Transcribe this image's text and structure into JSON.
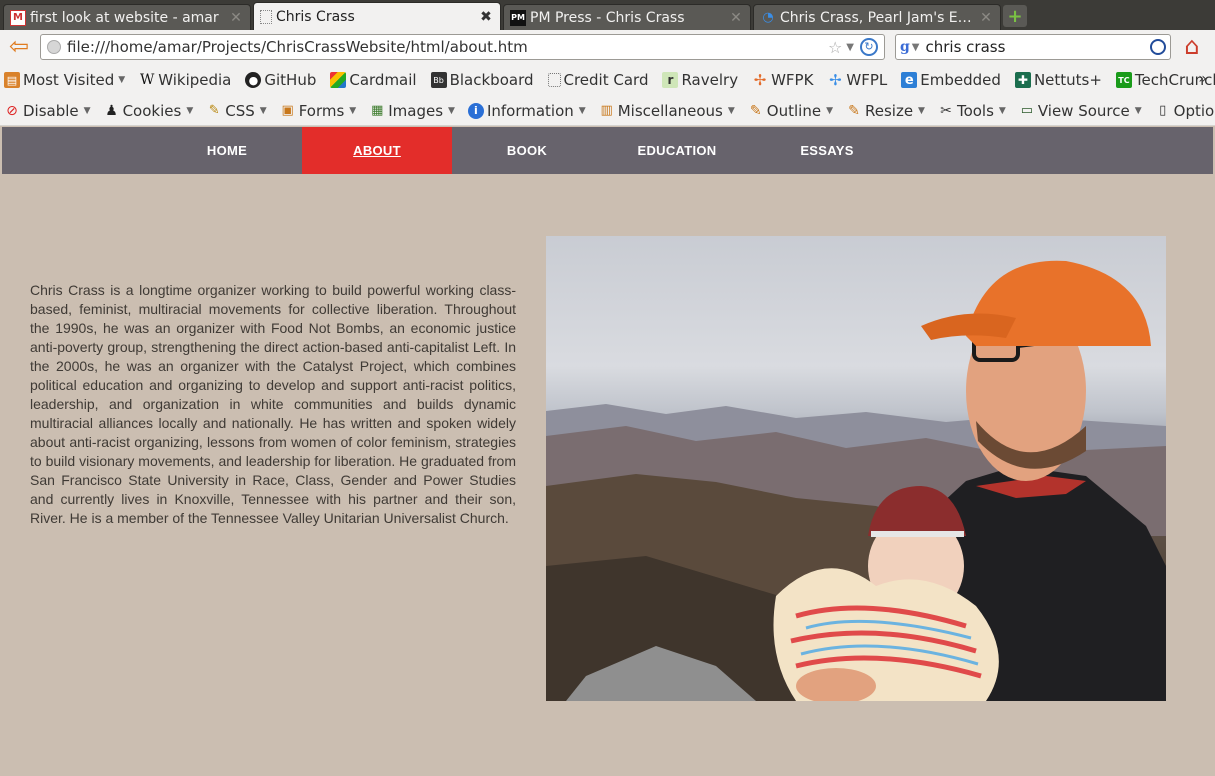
{
  "tabs": [
    {
      "title": "first look at website - amar",
      "icon": "gmail-icon",
      "active": false
    },
    {
      "title": "Chris Crass",
      "icon": "blank-page-icon",
      "active": true
    },
    {
      "title": "PM Press - Chris Crass",
      "icon": "pm-press-icon",
      "icon_text": "PM",
      "active": false
    },
    {
      "title": "Chris Crass, Pearl Jam's Ed...",
      "icon": "wifi-icon",
      "active": false
    }
  ],
  "toolbar": {
    "url": "file:///home/amar/Projects/ChrisCrassWebsite/html/about.htm",
    "search_value": "chris crass",
    "search_engine_letter": "g"
  },
  "bookmarks": [
    {
      "label": "Most Visited",
      "icon": "most-visited-icon",
      "dropdown": true
    },
    {
      "label": "Wikipedia",
      "icon": "wikipedia-icon",
      "icon_text": "W"
    },
    {
      "label": "GitHub",
      "icon": "github-icon"
    },
    {
      "label": "Cardmail",
      "icon": "cardmail-icon"
    },
    {
      "label": "Blackboard",
      "icon": "blackboard-icon",
      "icon_text": "Bb"
    },
    {
      "label": "Credit Card",
      "icon": "credit-card-icon"
    },
    {
      "label": "Ravelry",
      "icon": "ravelry-icon",
      "icon_text": "r"
    },
    {
      "label": "WFPK",
      "icon": "wfpk-icon"
    },
    {
      "label": "WFPL",
      "icon": "wfpl-icon"
    },
    {
      "label": "Embedded",
      "icon": "embedded-icon",
      "icon_text": "e"
    },
    {
      "label": "Nettuts+",
      "icon": "nettuts-icon"
    },
    {
      "label": "TechCrunch",
      "icon": "techcrunch-icon",
      "icon_text": "TC"
    }
  ],
  "bookmarks_more": "»",
  "devtoolbar": [
    {
      "label": "Disable",
      "icon": "disable-icon"
    },
    {
      "label": "Cookies",
      "icon": "cookies-icon"
    },
    {
      "label": "CSS",
      "icon": "css-icon"
    },
    {
      "label": "Forms",
      "icon": "forms-icon"
    },
    {
      "label": "Images",
      "icon": "images-icon"
    },
    {
      "label": "Information",
      "icon": "information-icon"
    },
    {
      "label": "Miscellaneous",
      "icon": "miscellaneous-icon"
    },
    {
      "label": "Outline",
      "icon": "outline-icon"
    },
    {
      "label": "Resize",
      "icon": "resize-icon"
    },
    {
      "label": "Tools",
      "icon": "tools-icon"
    },
    {
      "label": "View Source",
      "icon": "view-source-icon"
    },
    {
      "label": "Options",
      "icon": "options-icon"
    }
  ],
  "site": {
    "nav": [
      {
        "label": "HOME",
        "active": false
      },
      {
        "label": "ABOUT",
        "active": true
      },
      {
        "label": "BOOK",
        "active": false
      },
      {
        "label": "EDUCATION",
        "active": false
      },
      {
        "label": "ESSAYS",
        "active": false
      }
    ],
    "bio": "Chris Crass is a longtime organizer working to build powerful working class-based, feminist, multiracial movements for collective liberation. Throughout the 1990s, he was an organizer with Food Not Bombs, an economic justice anti-poverty group, strengthening the direct action-based anti-capitalist Left. In the 2000s, he was an organizer with the Catalyst Project, which combines political education and organizing to develop and support anti-racist politics, leadership, and organization in white communities and builds dynamic multiracial alliances locally and nationally. He has written and spoken widely about anti-racist organizing, lessons from women of color feminism, strategies to build visionary movements, and leadership for liberation. He graduated from San Francisco State University in Race, Class, Gender and Power Studies and currently lives in Knoxville, Tennessee with his partner and their son, River. He is a member of the Tennessee Valley Unitarian Universalist Church."
  },
  "colors": {
    "page_bg": "#cbbeb1",
    "nav_bg": "#67636c",
    "nav_active": "#e32d2a",
    "chrome_bg": "#f2f1f0"
  }
}
